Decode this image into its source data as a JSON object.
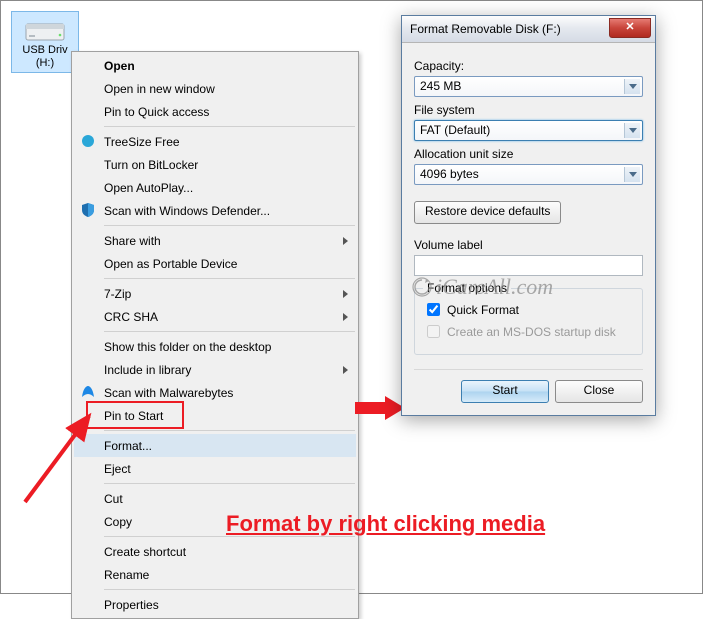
{
  "desktop": {
    "icon_label_line1": "USB Driv",
    "icon_label_line2": "(H:)"
  },
  "context_menu": {
    "items": [
      {
        "label": "Open",
        "bold": true
      },
      {
        "label": "Open in new window"
      },
      {
        "label": "Pin to Quick access"
      },
      {
        "sep": true
      },
      {
        "label": "TreeSize Free",
        "icon": "treesize-icon"
      },
      {
        "label": "Turn on BitLocker"
      },
      {
        "label": "Open AutoPlay..."
      },
      {
        "label": "Scan with Windows Defender...",
        "icon": "shield-icon"
      },
      {
        "sep": true
      },
      {
        "label": "Share with",
        "sub": true
      },
      {
        "label": "Open as Portable Device"
      },
      {
        "sep": true
      },
      {
        "label": "7-Zip",
        "sub": true
      },
      {
        "label": "CRC SHA",
        "sub": true
      },
      {
        "sep": true
      },
      {
        "label": "Show this folder on the desktop"
      },
      {
        "label": "Include in library",
        "sub": true
      },
      {
        "label": "Scan with Malwarebytes",
        "icon": "malwarebytes-icon"
      },
      {
        "label": "Pin to Start"
      },
      {
        "sep": true
      },
      {
        "label": "Format...",
        "hl": true
      },
      {
        "label": "Eject"
      },
      {
        "sep": true
      },
      {
        "label": "Cut"
      },
      {
        "label": "Copy"
      },
      {
        "sep": true
      },
      {
        "label": "Create shortcut"
      },
      {
        "label": "Rename"
      },
      {
        "sep": true
      },
      {
        "label": "Properties"
      }
    ]
  },
  "format_dialog": {
    "title": "Format Removable Disk (F:)",
    "capacity_label": "Capacity:",
    "capacity_value": "245 MB",
    "filesystem_label": "File system",
    "filesystem_value": "FAT (Default)",
    "alloc_label": "Allocation unit size",
    "alloc_value": "4096 bytes",
    "restore_btn": "Restore device defaults",
    "volume_label": "Volume label",
    "volume_value": "",
    "format_options_title": "Format options",
    "quick_format": "Quick Format",
    "msdos": "Create an MS-DOS startup disk",
    "start_btn": "Start",
    "close_btn": "Close"
  },
  "watermark": "iCareAll.com",
  "caption": "Format by right clicking media"
}
